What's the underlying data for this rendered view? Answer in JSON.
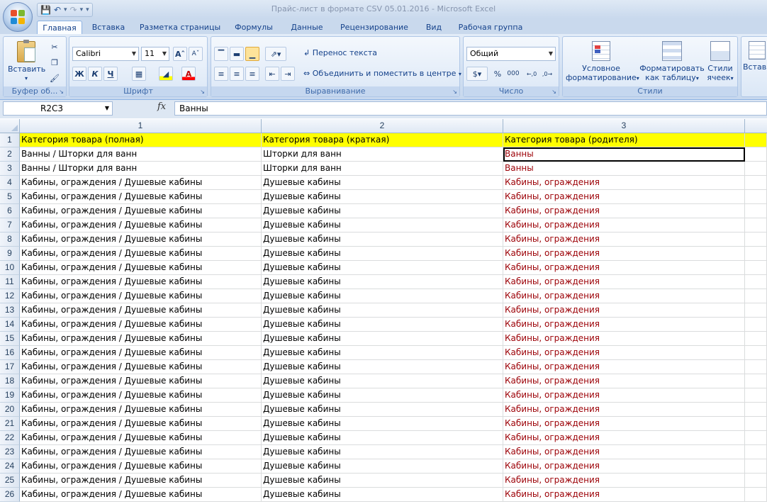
{
  "window": {
    "title": "Прайс-лист в формате CSV 05.01.2016 - Microsoft Excel"
  },
  "qat": {
    "save_icon": "save-icon",
    "undo_icon": "undo-icon",
    "redo_icon": "redo-icon",
    "customize_icon": "customize-qat-icon"
  },
  "tabs": [
    "Главная",
    "Вставка",
    "Разметка страницы",
    "Формулы",
    "Данные",
    "Рецензирование",
    "Вид",
    "Рабочая группа"
  ],
  "ribbon": {
    "clipboard": {
      "label": "Буфер об...",
      "paste": "Вставить"
    },
    "font": {
      "label": "Шрифт",
      "name": "Calibri",
      "size": "11",
      "bold": "Ж",
      "italic": "К",
      "underline": "Ч"
    },
    "alignment": {
      "label": "Выравнивание",
      "wrap": "Перенос текста",
      "merge": "Объединить и поместить в центре"
    },
    "number": {
      "label": "Число",
      "format": "Общий",
      "percent": "%",
      "thousands": "000",
      "inc_decimal": ",0 ,00",
      "dec_decimal": ",00 ,0"
    },
    "styles": {
      "label": "Стили",
      "conditional_l1": "Условное",
      "conditional_l2": "форматирование",
      "table_l1": "Форматировать",
      "table_l2": "как таблицу",
      "cell_l1": "Стили",
      "cell_l2": "ячеек"
    },
    "cells": {
      "insert": "Встав"
    }
  },
  "formula_bar": {
    "name_box": "R2C3",
    "fx": "fx",
    "value": "Ванны"
  },
  "grid": {
    "columns": [
      "1",
      "2",
      "3"
    ],
    "rows": [
      {
        "n": "1",
        "c1": "Категория товара (полная)",
        "c2": "Категория товара (краткая)",
        "c3": "Категория товара (родителя)"
      },
      {
        "n": "2",
        "c1": "Ванны / Шторки для ванн",
        "c2": "Шторки для ванн",
        "c3": "Ванны"
      },
      {
        "n": "3",
        "c1": "Ванны / Шторки для ванн",
        "c2": "Шторки для ванн",
        "c3": "Ванны"
      },
      {
        "n": "4",
        "c1": "Кабины, ограждения / Душевые кабины",
        "c2": "Душевые кабины",
        "c3": "Кабины, ограждения"
      },
      {
        "n": "5",
        "c1": "Кабины, ограждения / Душевые кабины",
        "c2": "Душевые кабины",
        "c3": "Кабины, ограждения"
      },
      {
        "n": "6",
        "c1": "Кабины, ограждения / Душевые кабины",
        "c2": "Душевые кабины",
        "c3": "Кабины, ограждения"
      },
      {
        "n": "7",
        "c1": "Кабины, ограждения / Душевые кабины",
        "c2": "Душевые кабины",
        "c3": "Кабины, ограждения"
      },
      {
        "n": "8",
        "c1": "Кабины, ограждения / Душевые кабины",
        "c2": "Душевые кабины",
        "c3": "Кабины, ограждения"
      },
      {
        "n": "9",
        "c1": "Кабины, ограждения / Душевые кабины",
        "c2": "Душевые кабины",
        "c3": "Кабины, ограждения"
      },
      {
        "n": "10",
        "c1": "Кабины, ограждения / Душевые кабины",
        "c2": "Душевые кабины",
        "c3": "Кабины, ограждения"
      },
      {
        "n": "11",
        "c1": "Кабины, ограждения / Душевые кабины",
        "c2": "Душевые кабины",
        "c3": "Кабины, ограждения"
      },
      {
        "n": "12",
        "c1": "Кабины, ограждения / Душевые кабины",
        "c2": "Душевые кабины",
        "c3": "Кабины, ограждения"
      },
      {
        "n": "13",
        "c1": "Кабины, ограждения / Душевые кабины",
        "c2": "Душевые кабины",
        "c3": "Кабины, ограждения"
      },
      {
        "n": "14",
        "c1": "Кабины, ограждения / Душевые кабины",
        "c2": "Душевые кабины",
        "c3": "Кабины, ограждения"
      },
      {
        "n": "15",
        "c1": "Кабины, ограждения / Душевые кабины",
        "c2": "Душевые кабины",
        "c3": "Кабины, ограждения"
      },
      {
        "n": "16",
        "c1": "Кабины, ограждения / Душевые кабины",
        "c2": "Душевые кабины",
        "c3": "Кабины, ограждения"
      },
      {
        "n": "17",
        "c1": "Кабины, ограждения / Душевые кабины",
        "c2": "Душевые кабины",
        "c3": "Кабины, ограждения"
      },
      {
        "n": "18",
        "c1": "Кабины, ограждения / Душевые кабины",
        "c2": "Душевые кабины",
        "c3": "Кабины, ограждения"
      },
      {
        "n": "19",
        "c1": "Кабины, ограждения / Душевые кабины",
        "c2": "Душевые кабины",
        "c3": "Кабины, ограждения"
      },
      {
        "n": "20",
        "c1": "Кабины, ограждения / Душевые кабины",
        "c2": "Душевые кабины",
        "c3": "Кабины, ограждения"
      },
      {
        "n": "21",
        "c1": "Кабины, ограждения / Душевые кабины",
        "c2": "Душевые кабины",
        "c3": "Кабины, ограждения"
      },
      {
        "n": "22",
        "c1": "Кабины, ограждения / Душевые кабины",
        "c2": "Душевые кабины",
        "c3": "Кабины, ограждения"
      },
      {
        "n": "23",
        "c1": "Кабины, ограждения / Душевые кабины",
        "c2": "Душевые кабины",
        "c3": "Кабины, ограждения"
      },
      {
        "n": "24",
        "c1": "Кабины, ограждения / Душевые кабины",
        "c2": "Душевые кабины",
        "c3": "Кабины, ограждения"
      },
      {
        "n": "25",
        "c1": "Кабины, ограждения / Душевые кабины",
        "c2": "Душевые кабины",
        "c3": "Кабины, ограждения"
      },
      {
        "n": "26",
        "c1": "Кабины, ограждения / Душевые кабины",
        "c2": "Душевые кабины",
        "c3": "Кабины, ограждения"
      }
    ]
  },
  "colors": {
    "header_fill": "#ffff00",
    "parent_text": "#9c0006",
    "ribbon_bg": "#c9d9ed"
  }
}
